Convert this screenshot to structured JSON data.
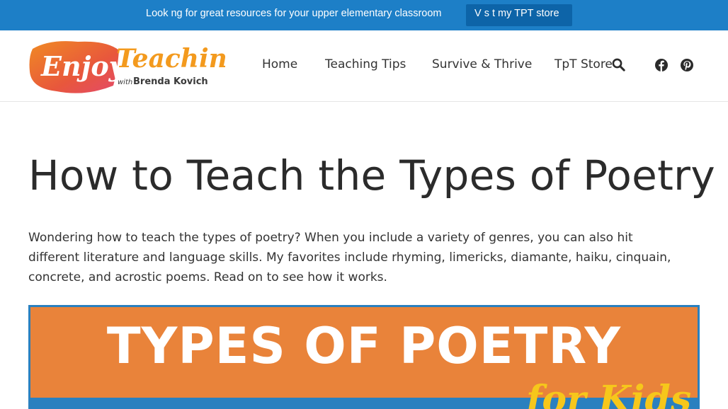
{
  "announcement": {
    "text": "Look ng for great resources for your upper elementary classroom",
    "button_label": "V s t my TPT store"
  },
  "header": {
    "logo": {
      "title": "Enjoy Teaching",
      "subtitle_prefix": "with",
      "subtitle_name": "Brenda Kovich"
    },
    "nav": [
      {
        "label": "Home"
      },
      {
        "label": "Teaching Tips"
      },
      {
        "label": "Survive & Thrive"
      },
      {
        "label": "TpT Store"
      }
    ],
    "icons": [
      "search-icon",
      "facebook-icon",
      "pinterest-icon"
    ]
  },
  "article": {
    "title": "How to Teach the Types of Poetry",
    "intro": "Wondering how to teach the types of poetry? When you include a variety of genres, you can also hit different literature and language skills. My favorites include rhyming, limericks, diamante, haiku, cinquain, concrete, and acrostic poems. Read on to see how it works.",
    "hero_image": {
      "title": "TYPES OF POETRY",
      "subtitle": "for Kids"
    }
  },
  "colors": {
    "topbar": "#1d7fc7",
    "button": "#0d64a8",
    "hero_orange": "#e9833a",
    "hero_blue": "#2a80bf",
    "accent_yellow": "#f6c71b"
  }
}
